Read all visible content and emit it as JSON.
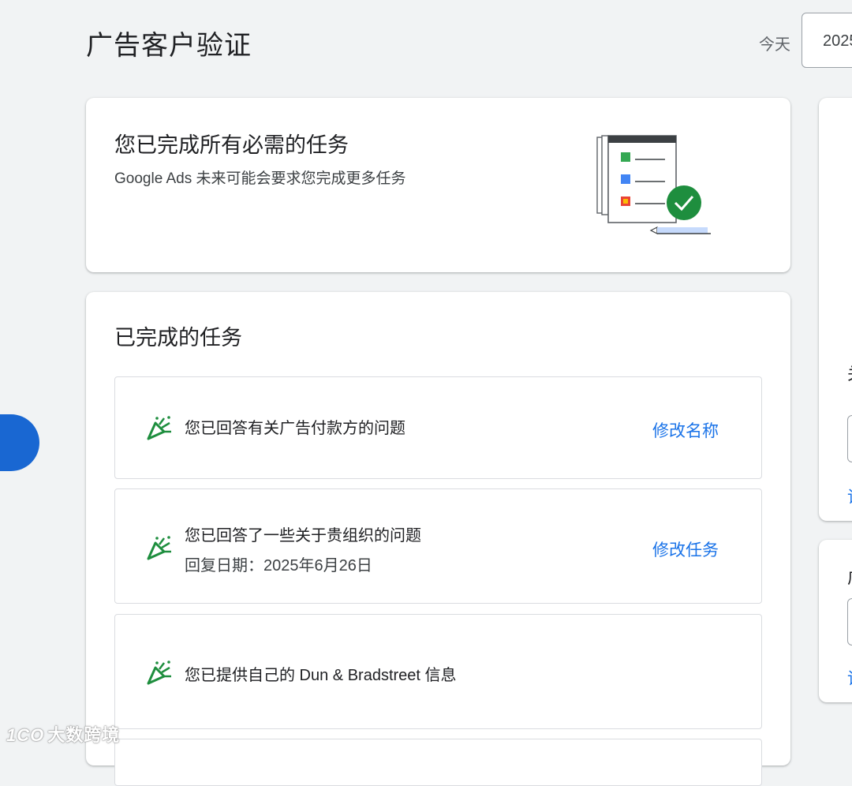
{
  "header": {
    "page_title": "广告客户验证",
    "date_label": "今天",
    "date_value": "2025"
  },
  "summary_card": {
    "title": "您已完成所有必需的任务",
    "subtitle": "Google Ads 未来可能会要求您完成更多任务",
    "illustration": "checklist-complete-illustration"
  },
  "completed_tasks": {
    "title": "已完成的任务",
    "items": [
      {
        "text": "您已回答有关广告付款方的问题",
        "action": "修改名称",
        "icon": "party-popper-icon"
      },
      {
        "text": "您已回答了一些关于贵组织的问题",
        "sub": "回复日期：2025年6月26日",
        "action": "修改任务",
        "icon": "party-popper-icon"
      },
      {
        "text": "您已提供自己的 Dun & Bradstreet 信息",
        "icon": "party-popper-icon"
      }
    ]
  },
  "right_panel": {
    "frag1": "关",
    "frag2": "广",
    "link1": "详",
    "link2": "详"
  },
  "watermark": {
    "logo": "1CO",
    "text": "大数跨境"
  },
  "colors": {
    "accent": "#1a73e8",
    "success": "#1e8e3e",
    "background": "#f1f3f4"
  }
}
